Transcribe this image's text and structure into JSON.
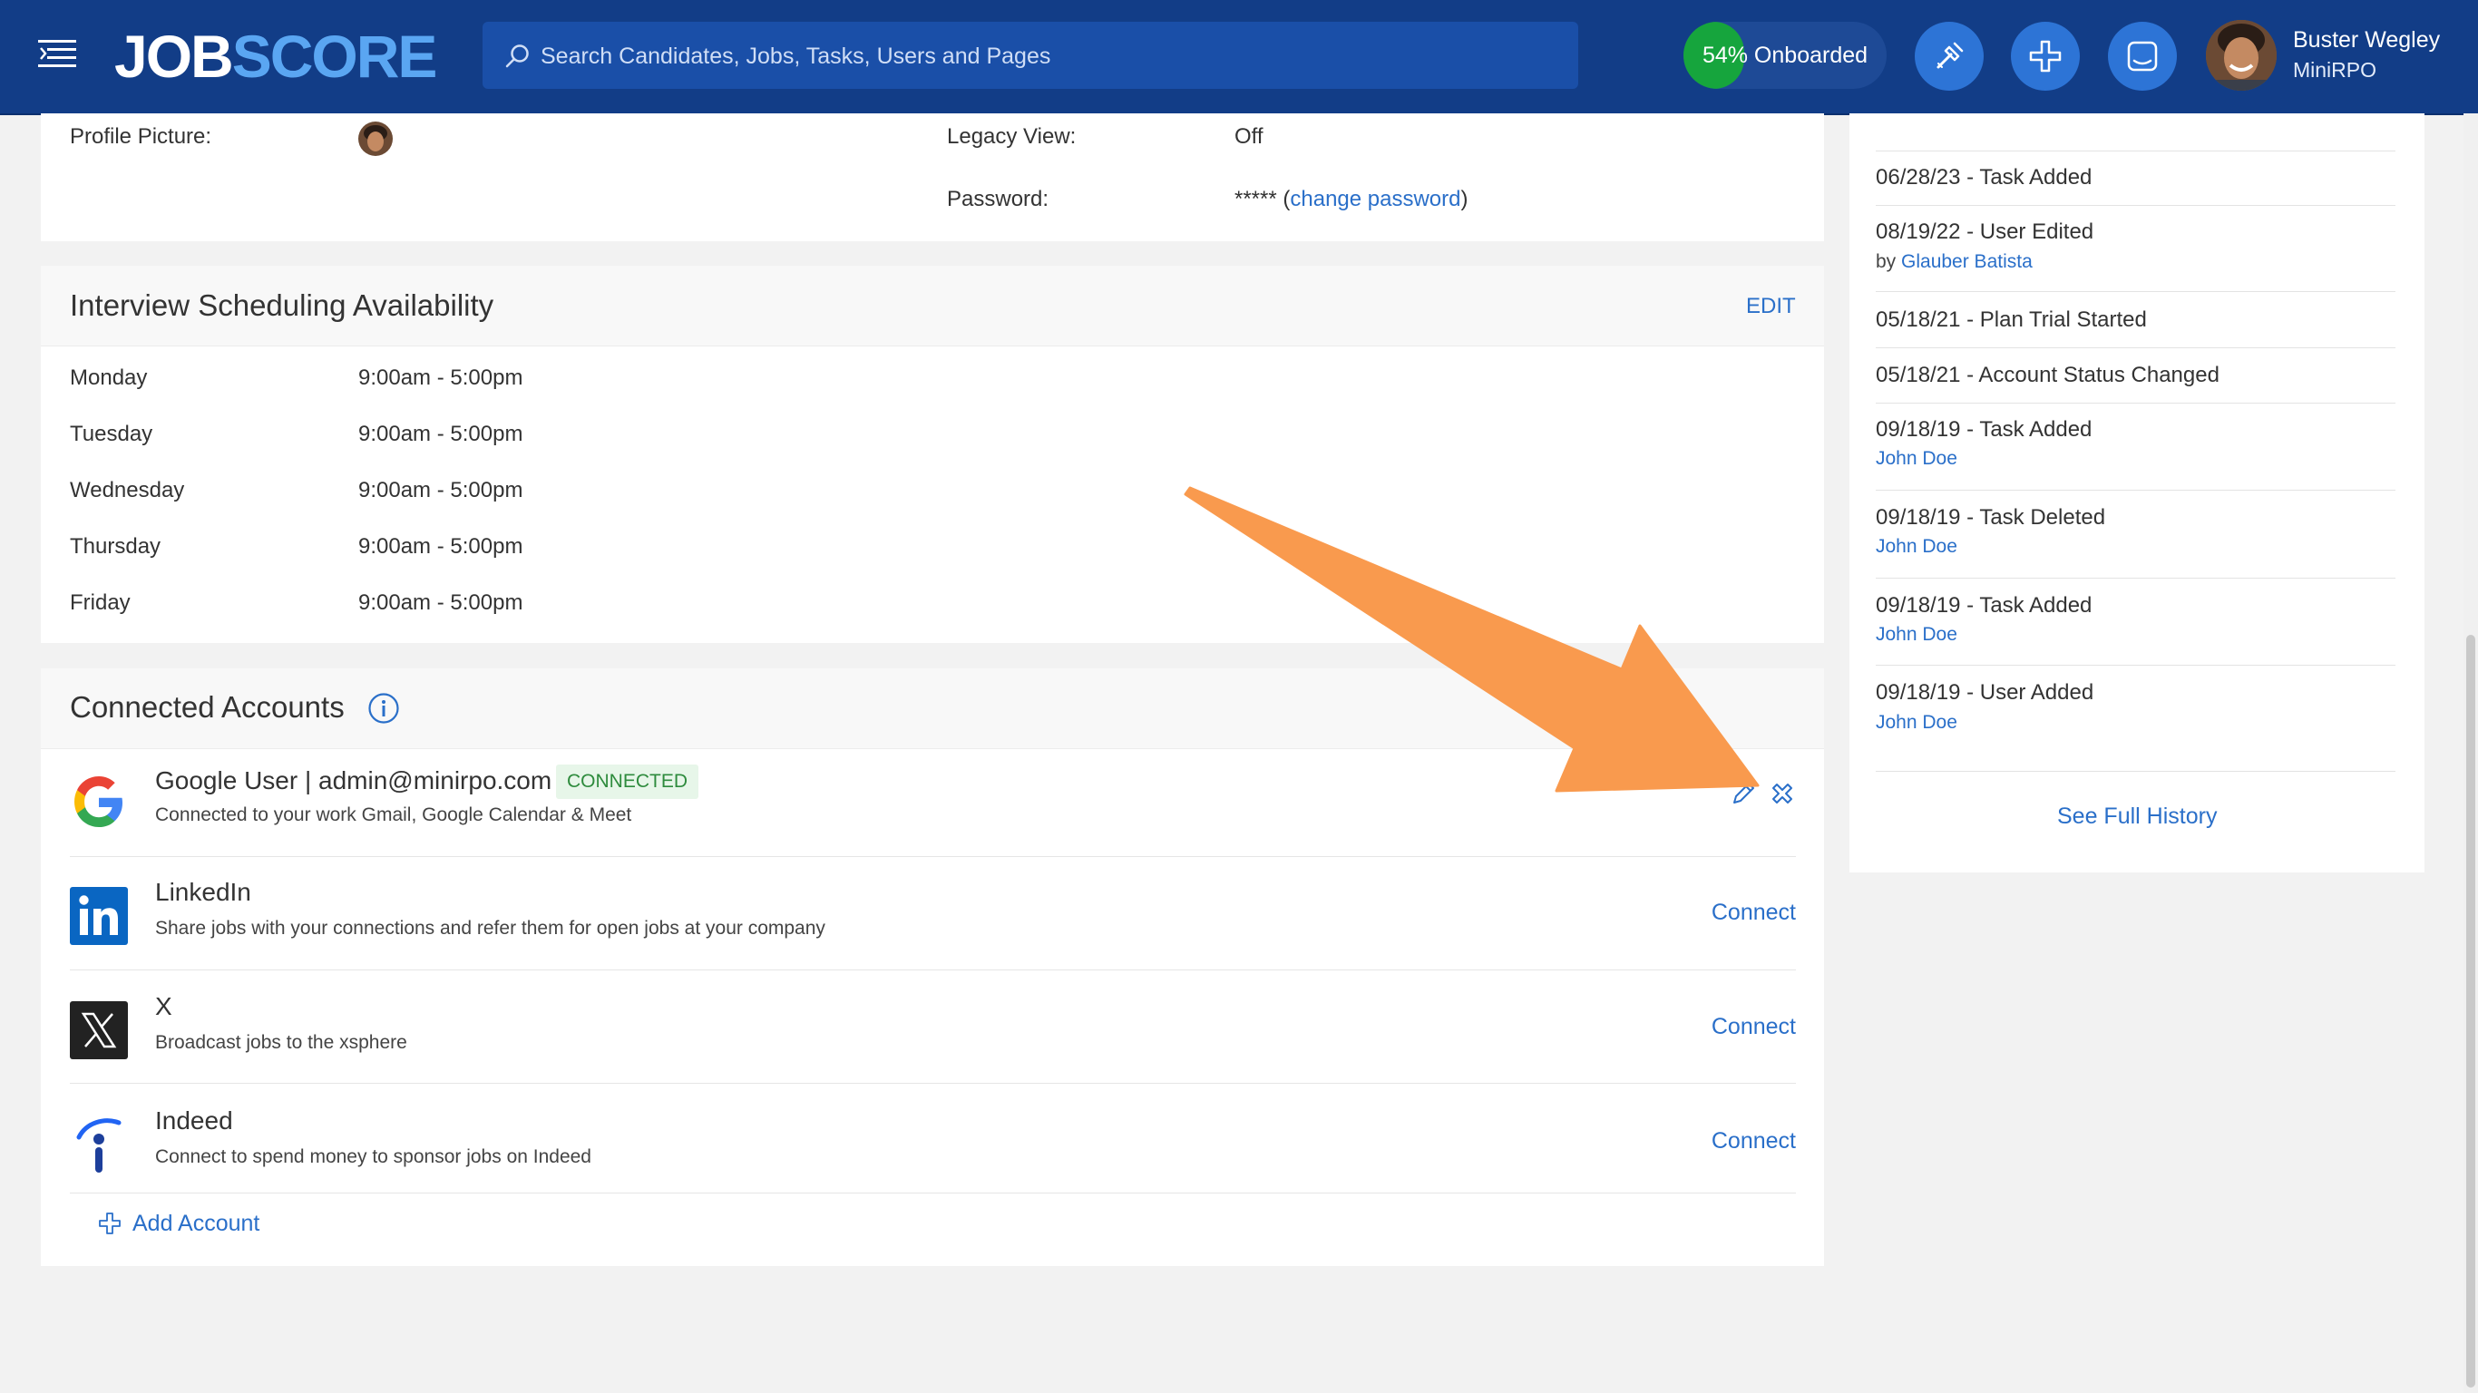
{
  "header": {
    "logo_part1": "JOB",
    "logo_part2": "SCORE",
    "search_placeholder": "Search Candidates, Jobs, Tasks, Users and Pages",
    "onboard_label": "54% Onboarded",
    "onboard_progress": 0.3,
    "user_name": "Buster Wegley",
    "user_org": "MiniRPO"
  },
  "profile": {
    "picture_label": "Profile Picture:",
    "legacy_label": "Legacy View:",
    "legacy_value": "Off",
    "password_label": "Password:",
    "password_mask": "*****",
    "change_password": "change password",
    "paren_open": "(",
    "paren_close": ")"
  },
  "schedule": {
    "title": "Interview Scheduling Availability",
    "edit": "EDIT",
    "days": [
      {
        "day": "Monday",
        "hours": "9:00am - 5:00pm"
      },
      {
        "day": "Tuesday",
        "hours": "9:00am - 5:00pm"
      },
      {
        "day": "Wednesday",
        "hours": "9:00am - 5:00pm"
      },
      {
        "day": "Thursday",
        "hours": "9:00am - 5:00pm"
      },
      {
        "day": "Friday",
        "hours": "9:00am - 5:00pm"
      }
    ]
  },
  "accounts": {
    "title": "Connected Accounts",
    "items": [
      {
        "name": "Google User | admin@minirpo.com",
        "badge": "CONNECTED",
        "desc": "Connected to your work Gmail, Google Calendar & Meet",
        "icon": "google-icon"
      },
      {
        "name": "LinkedIn",
        "desc": "Share jobs with your connections and refer them for open jobs at your company",
        "action": "Connect",
        "icon": "linkedin-icon"
      },
      {
        "name": "X",
        "desc": "Broadcast jobs to the xsphere",
        "action": "Connect",
        "icon": "x-icon"
      },
      {
        "name": "Indeed",
        "desc": "Connect to spend money to sponsor jobs on Indeed",
        "action": "Connect",
        "icon": "indeed-icon"
      }
    ],
    "add_account": "Add Account"
  },
  "history": {
    "items": [
      {
        "text": "06/28/23 - Task Added"
      },
      {
        "text": "08/19/22 - User Edited",
        "by_prefix": "by ",
        "by": "Glauber Batista"
      },
      {
        "text": "05/18/21 - Plan Trial Started"
      },
      {
        "text": "05/18/21 - Account Status Changed"
      },
      {
        "text": "09/18/19 - Task Added",
        "by": "John Doe"
      },
      {
        "text": "09/18/19 - Task Deleted",
        "by": "John Doe"
      },
      {
        "text": "09/18/19 - Task Added",
        "by": "John Doe"
      },
      {
        "text": "09/18/19 - User Added",
        "by": "John Doe"
      }
    ],
    "see_full": "See Full History"
  },
  "colors": {
    "header_bg": "#123d87",
    "accent": "#2a6fc9",
    "onboard_green": "#16a53d",
    "annotation_orange": "#f99a4e"
  }
}
